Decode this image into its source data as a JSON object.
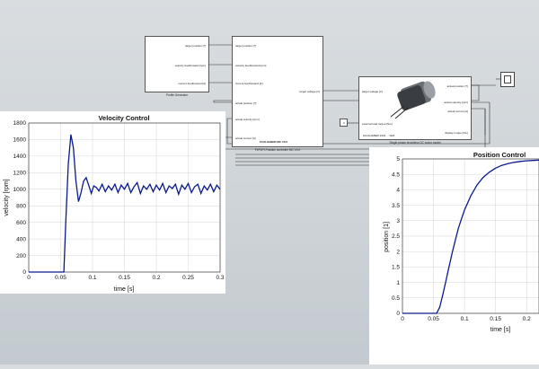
{
  "model": {
    "profile_generator": {
      "caption": "Profile Generator",
      "ports": [
        "target position [?]",
        "velocity feedforward [rpm]",
        "current feedforward [A]"
      ]
    },
    "controller": {
      "title": "FAULHABER MC V3.0",
      "caption": "PI/PI/PI-Position controller MC V3.0",
      "inputs": [
        "target position [?]",
        "velocity feedforward [rpm]",
        "current feedforward [A]",
        "actual position [?]",
        "actual velocity [rpm]",
        "actual current [A]"
      ],
      "outputs": [
        "target voltage [V]"
      ]
    },
    "motor": {
      "title": "FAULHABER 2232 ... SR4",
      "caption": "Single phase brushless DC motor model",
      "inputs": [
        "target voltage [V]",
        "external load torque [Nm]"
      ],
      "outputs": [
        "actual position [?]",
        "actual velocity [rpm]",
        "actual current [A]",
        "display torque [Nm]"
      ]
    },
    "constant": {
      "value": "0"
    }
  },
  "chart_data": [
    {
      "type": "line",
      "title": "Velocity Control",
      "xlabel": "time [s]",
      "ylabel": "velocity [rpm]",
      "xlim": [
        0,
        0.3
      ],
      "ylim": [
        0,
        1800
      ],
      "xticks": [
        "0",
        "0.05",
        "0.1",
        "0.15",
        "0.2",
        "0.25",
        "0.3"
      ],
      "yticks": [
        "0",
        "200",
        "400",
        "600",
        "800",
        "1000",
        "1200",
        "1400",
        "1600",
        "1800"
      ],
      "grid": true,
      "series": [
        {
          "color": "#0a1a8c",
          "x": [
            0,
            0.055,
            0.058,
            0.062,
            0.066,
            0.07,
            0.074,
            0.078,
            0.082,
            0.086,
            0.09,
            0.094,
            0.098,
            0.102,
            0.106,
            0.11,
            0.115,
            0.12,
            0.125,
            0.13,
            0.135,
            0.14,
            0.145,
            0.15,
            0.155,
            0.16,
            0.165,
            0.17,
            0.175,
            0.18,
            0.185,
            0.19,
            0.195,
            0.2,
            0.205,
            0.21,
            0.215,
            0.22,
            0.225,
            0.23,
            0.235,
            0.24,
            0.245,
            0.25,
            0.255,
            0.26,
            0.265,
            0.27,
            0.275,
            0.28,
            0.285,
            0.29,
            0.295,
            0.3
          ],
          "y": [
            0,
            0,
            600,
            1300,
            1660,
            1500,
            1100,
            850,
            960,
            1100,
            1140,
            1050,
            950,
            1040,
            1020,
            980,
            1060,
            970,
            1040,
            990,
            1060,
            960,
            1050,
            1000,
            1070,
            960,
            1030,
            1080,
            950,
            1040,
            1000,
            1060,
            970,
            1050,
            990,
            1070,
            960,
            1040,
            1010,
            1060,
            940,
            1050,
            1000,
            1070,
            960,
            1030,
            1060,
            950,
            1040,
            990,
            1060,
            970,
            1050,
            1000
          ]
        }
      ]
    },
    {
      "type": "line",
      "title": "Position Control",
      "xlabel": "time [s]",
      "ylabel": "position [1]",
      "xlim": [
        0,
        0.22
      ],
      "ylim": [
        0,
        5
      ],
      "xticks": [
        "0",
        "0.05",
        "0.1",
        "0.15",
        "0.2"
      ],
      "yticks": [
        "0",
        "0.5",
        "1",
        "1.5",
        "2",
        "2.5",
        "3",
        "3.5",
        "4",
        "4.5",
        "5"
      ],
      "grid": true,
      "series": [
        {
          "color": "#0a1a8c",
          "x": [
            0,
            0.055,
            0.06,
            0.065,
            0.07,
            0.075,
            0.08,
            0.085,
            0.09,
            0.095,
            0.1,
            0.11,
            0.12,
            0.13,
            0.14,
            0.15,
            0.16,
            0.17,
            0.18,
            0.19,
            0.2,
            0.21,
            0.22
          ],
          "y": [
            0,
            0,
            0.2,
            0.6,
            1.05,
            1.5,
            1.95,
            2.35,
            2.75,
            3.05,
            3.35,
            3.8,
            4.15,
            4.4,
            4.57,
            4.7,
            4.79,
            4.85,
            4.89,
            4.92,
            4.94,
            4.95,
            4.96
          ]
        }
      ]
    }
  ]
}
